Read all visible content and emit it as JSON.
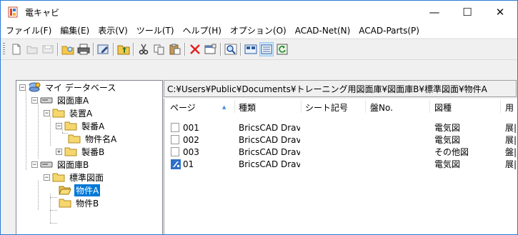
{
  "window": {
    "title": "電キャビ"
  },
  "controls": {
    "minimize": "—",
    "maximize": "☐",
    "close": "✕"
  },
  "menu": [
    "ファイル(F)",
    "編集(E)",
    "表示(V)",
    "ツール(T)",
    "ヘルプ(H)",
    "オプション(O)",
    "ACAD-Net(N)",
    "ACAD-Parts(P)"
  ],
  "toolbar": {
    "icons": [
      "new-file-icon",
      "open-folder-icon",
      "save-icon",
      "folder-search-icon",
      "print-icon",
      "edit-icon",
      "parent-folder-icon",
      "cut-icon",
      "copy-icon",
      "paste-icon",
      "delete-icon",
      "properties-icon",
      "search-icon",
      "large-icon-view-icon",
      "details-view-icon",
      "refresh-icon"
    ]
  },
  "tree": {
    "root": "マイ データベース",
    "library_a": "図面庫A",
    "device_a": "装置A",
    "part_a": "製番A",
    "item_a_name": "物件名A",
    "part_b": "製番B",
    "library_b": "図面庫B",
    "standard": "標準図面",
    "item_a": "物件A",
    "item_b": "物件B"
  },
  "path": "C:¥Users¥Public¥Documents¥トレーニング用図面庫¥図面庫B¥標準図面¥物件A",
  "columns": [
    "ページ",
    "種類",
    "シート記号",
    "盤No.",
    "図種",
    "用"
  ],
  "rows": [
    {
      "page": "001",
      "type": "BricsCAD Drav",
      "sheet": "",
      "panel": "",
      "kind": "電気図",
      "use": "展|",
      "icon": "document-icon"
    },
    {
      "page": "002",
      "type": "BricsCAD Drav",
      "sheet": "",
      "panel": "",
      "kind": "電気図",
      "use": "展|",
      "icon": "document-icon"
    },
    {
      "page": "003",
      "type": "BricsCAD Drav",
      "sheet": "",
      "panel": "",
      "kind": "その他図",
      "use": "盤|",
      "icon": "document-icon"
    },
    {
      "page": "01",
      "type": "BricsCAD Drav",
      "sheet": "",
      "panel": "",
      "kind": "電気図",
      "use": "展|",
      "icon": "bricscad-icon"
    }
  ],
  "colors": {
    "selection": "#0078d7",
    "folder": "#f5d76e",
    "accent_border": "#2b79d6"
  }
}
